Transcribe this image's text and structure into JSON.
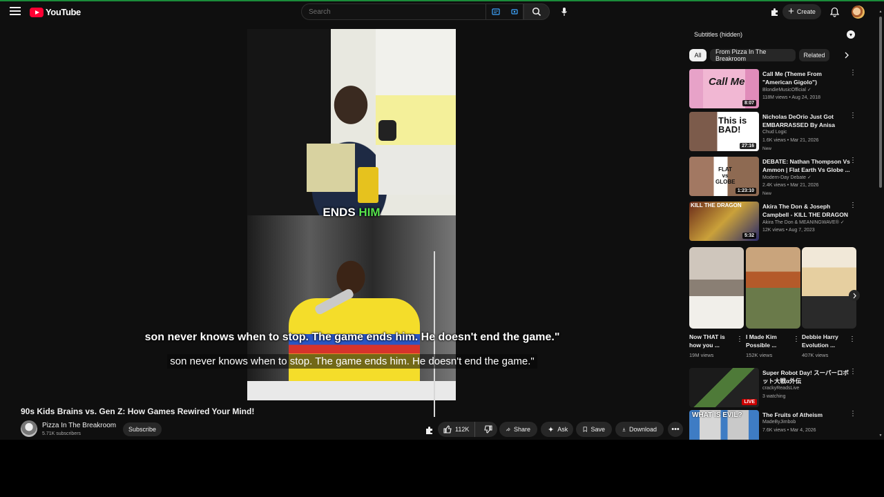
{
  "header": {
    "logo_text": "YouTube",
    "search_placeholder": "Search",
    "create_label": "Create"
  },
  "video": {
    "burned_caption_prefix": "ENDS ",
    "burned_caption_highlight": "HIM",
    "subtitle_line_1": "son never knows when to stop. The game ends him. He doesn't end the game.\"",
    "subtitle_line_2": "son never knows when to stop. The game ends him. He doesn't end the game.\"",
    "title": "90s Kids Brains vs. Gen Z: How Games Rewired Your Mind!"
  },
  "channel": {
    "name": "Pizza In The Breakroom",
    "subscribers": "5.71K subscribers",
    "subscribe_label": "Subscribe"
  },
  "actions": {
    "likes": "112K",
    "share_label": "Share",
    "ask_label": "Ask",
    "save_label": "Save",
    "download_label": "Download"
  },
  "sidebar": {
    "subtitles_dropdown": "Subtitles (hidden)",
    "chips": [
      "All",
      "From Pizza In The Breakroom",
      "Related"
    ],
    "recommendations": [
      {
        "title": "Call Me (Theme From \"American Gigolo\")",
        "channel": "BlondieMusicOfficial ✓",
        "meta": "118M views • Aug 24, 2018",
        "duration": "8:07",
        "badge": "",
        "thumb_text": "Call Me"
      },
      {
        "title": "Nicholas DeOrio Just Got EMBARRASSED By Anisa",
        "channel": "Chud Logic",
        "meta": "1.6K views • Mar 21, 2026",
        "duration": "27:16",
        "badge": "New",
        "thumb_text": "This is BAD!"
      },
      {
        "title": "DEBATE: Nathan Thompson Vs Ammon | Flat Earth Vs Globe ...",
        "channel": "Modern-Day Debate ✓",
        "meta": "2.4K views • Mar 21, 2026",
        "duration": "1:23:10",
        "badge": "New",
        "thumb_text": "FLAT vs GLOBE"
      },
      {
        "title": "Akira The Don & Joseph Campbell - KILL THE DRAGON ...",
        "channel": "Akira The Don & MEANINGWAVE® ✓",
        "meta": "12K views • Aug 7, 2023",
        "duration": "5:32",
        "badge": "",
        "thumb_text": "KILL THE DRAGON"
      },
      {
        "title": "Super Robot Day! スーパーロボット大戦α外伝",
        "channel": "crackyReadsLive",
        "meta": "3 watching",
        "duration": "",
        "badge": "LIVE",
        "thumb_text": ""
      },
      {
        "title": "The Fruits of Atheism",
        "channel": "MadeByJimbob",
        "meta": "7.6K views • Mar 4, 2026",
        "duration": "",
        "badge": "",
        "thumb_text": "WHAT IS EVIL?"
      }
    ],
    "shorts": [
      {
        "title": "Now THAT is how you ...",
        "views": "19M views"
      },
      {
        "title": "I Made Kim Possible ...",
        "views": "152K views"
      },
      {
        "title": "Debbie Harry Evolution ...",
        "views": "407K views"
      }
    ]
  },
  "icons": {
    "menu": "hamburger-menu-icon",
    "search": "search-icon",
    "mic": "microphone-icon",
    "bell": "notifications-bell-icon",
    "like": "thumbs-up-icon",
    "dislike": "thumbs-down-icon"
  }
}
